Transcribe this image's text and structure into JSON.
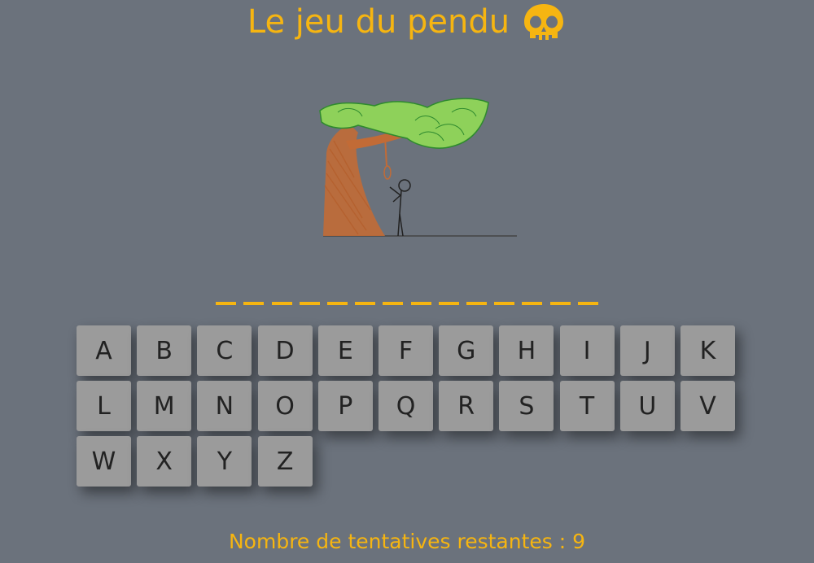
{
  "title": "Le jeu du pendu",
  "title_icon": "skull-icon",
  "accent_color": "#f6b511",
  "background_color": "#6b727c",
  "word_blank_count": 14,
  "keyboard": {
    "rows": [
      [
        "A",
        "B",
        "C",
        "D",
        "E",
        "F",
        "G",
        "H",
        "I",
        "J",
        "K"
      ],
      [
        "L",
        "M",
        "N",
        "O",
        "P",
        "Q",
        "R",
        "S",
        "T",
        "U",
        "V"
      ],
      [
        "W",
        "X",
        "Y",
        "Z"
      ]
    ]
  },
  "status": {
    "text": "Nombre de tentatives restantes : 9",
    "remaining_attempts": 9
  }
}
